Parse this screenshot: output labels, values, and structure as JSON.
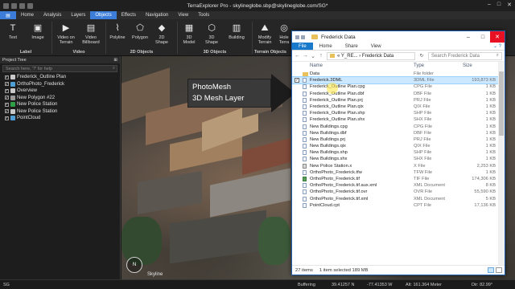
{
  "app": {
    "title": "TerraExplorer Pro - skylineglobe.sbp@skylineglobe.com/SG*"
  },
  "menu": {
    "file": "",
    "items": [
      "Home",
      "Analysis",
      "Layers",
      "Objects",
      "Effects",
      "Navigation",
      "View",
      "Tools"
    ],
    "active": "Objects"
  },
  "ribbon": {
    "buttons": [
      {
        "label": "Text",
        "icon": "text-icon"
      },
      {
        "label": "Image",
        "icon": "image-icon"
      },
      {
        "label": "Video on Terrain",
        "icon": "video-terrain-icon"
      },
      {
        "label": "Video Billboard",
        "icon": "video-billboard-icon"
      },
      {
        "label": "Polyline",
        "icon": "polyline-icon"
      },
      {
        "label": "Polygon",
        "icon": "polygon-icon"
      },
      {
        "label": "2D Shape",
        "icon": "shape-2d-icon"
      },
      {
        "label": "3D Model",
        "icon": "model-3d-icon"
      },
      {
        "label": "3D Shape",
        "icon": "shape-3d-icon"
      },
      {
        "label": "Building",
        "icon": "building-icon"
      },
      {
        "label": "Modify Terrain",
        "icon": "modify-terrain-icon"
      },
      {
        "label": "Hole Terra",
        "icon": "hole-terrain-icon"
      }
    ],
    "groups": [
      "Label",
      "Video",
      "2D Objects",
      "3D Objects",
      "Terrain Objects"
    ]
  },
  "tree": {
    "header": "Project Tree",
    "search_placeholder": "Search here, '?' for help",
    "items": [
      {
        "label": "Frederick_Outline Plan",
        "checked": true,
        "color": "#c9c9c9"
      },
      {
        "label": "OrthoPhoto_Frederick",
        "checked": true,
        "color": "#4f9fd6"
      },
      {
        "label": "Overview",
        "checked": true,
        "color": "#c9c9c9"
      },
      {
        "label": "New Polygon #22",
        "checked": true,
        "color": "#9a9a9a"
      },
      {
        "label": "New Police Station",
        "checked": true,
        "color": "#2f9e44"
      },
      {
        "label": "New Police Station",
        "checked": true,
        "color": "#c9c9c9"
      },
      {
        "label": "PointCloud",
        "checked": true,
        "color": "#4f9fd6"
      }
    ]
  },
  "callout": {
    "line1": "PhotoMesh",
    "line2": "3D Mesh Layer"
  },
  "viewport": {
    "watermark": "Skyline"
  },
  "statusbar": {
    "sg": "SG",
    "buffering": "Buffering",
    "lat": "39.41257 N",
    "lon": "-77.41353 W",
    "alt": "Alt: 161.364 Meter",
    "dir": "Dir: 82.99°"
  },
  "explorer": {
    "title": "Frederick Data",
    "tabs": [
      "File",
      "Home",
      "Share",
      "View"
    ],
    "path": "« Y_RE... › Frederick Data",
    "search_placeholder": "Search Frederick Data",
    "columns": {
      "name": "Name",
      "type": "Type",
      "size": "Size"
    },
    "files": [
      {
        "name": "Data",
        "type": "File folder",
        "size": "",
        "kind": "folder",
        "checked": false
      },
      {
        "name": "Frederick.3DML",
        "type": "3DML File",
        "size": "193,873 KB",
        "kind": "file",
        "checked": true
      },
      {
        "name": "Frederick_Outline Plan.cpg",
        "type": "CPG File",
        "size": "1 KB",
        "kind": "file",
        "checked": false
      },
      {
        "name": "Frederick_Outline Plan.dbf",
        "type": "DBF File",
        "size": "1 KB",
        "kind": "file",
        "checked": false
      },
      {
        "name": "Frederick_Outline Plan.prj",
        "type": "PRJ File",
        "size": "1 KB",
        "kind": "file",
        "checked": false
      },
      {
        "name": "Frederick_Outline Plan.qix",
        "type": "QIX File",
        "size": "1 KB",
        "kind": "file",
        "checked": false
      },
      {
        "name": "Frederick_Outline Plan.shp",
        "type": "SHP File",
        "size": "1 KB",
        "kind": "file",
        "checked": false
      },
      {
        "name": "Frederick_Outline Plan.shx",
        "type": "SHX File",
        "size": "1 KB",
        "kind": "file",
        "checked": false
      },
      {
        "name": "New Buildings.cpg",
        "type": "CPG File",
        "size": "1 KB",
        "kind": "file",
        "checked": false
      },
      {
        "name": "New Buildings.dbf",
        "type": "DBF File",
        "size": "1 KB",
        "kind": "file",
        "checked": false
      },
      {
        "name": "New Buildings.prj",
        "type": "PRJ File",
        "size": "1 KB",
        "kind": "file",
        "checked": false
      },
      {
        "name": "New Buildings.qix",
        "type": "QIX File",
        "size": "1 KB",
        "kind": "file",
        "checked": false
      },
      {
        "name": "New Buildings.shp",
        "type": "SHP File",
        "size": "1 KB",
        "kind": "file",
        "checked": false
      },
      {
        "name": "New Buildings.shx",
        "type": "SHX File",
        "size": "1 KB",
        "kind": "file",
        "checked": false
      },
      {
        "name": "New Police Station.x",
        "type": "X File",
        "size": "2,253 KB",
        "kind": "x",
        "checked": false
      },
      {
        "name": "OrthoPhoto_Frederick.tfw",
        "type": "TFW File",
        "size": "1 KB",
        "kind": "file",
        "checked": false
      },
      {
        "name": "OrthoPhoto_Frederick.tif",
        "type": "TIF File",
        "size": "174,306 KB",
        "kind": "img",
        "checked": false
      },
      {
        "name": "OrthoPhoto_Frederick.tif.aux.xml",
        "type": "XML Document",
        "size": "8 KB",
        "kind": "file",
        "checked": false
      },
      {
        "name": "OrthoPhoto_Frederick.tif.ovr",
        "type": "OVR File",
        "size": "55,590 KB",
        "kind": "file",
        "checked": false
      },
      {
        "name": "OrthoPhoto_Frederick.tif.xml",
        "type": "XML Document",
        "size": "5 KB",
        "kind": "file",
        "checked": false
      },
      {
        "name": "PointCloud.cpt",
        "type": "CPT File",
        "size": "17,136 KB",
        "kind": "file",
        "checked": false
      }
    ],
    "status_items": "27 items",
    "status_selected": "1 item selected  189 MB"
  },
  "colors": {
    "accent": "#3b7dd8",
    "explorer_accent": "#1979ca",
    "selection": "#cce8ff"
  }
}
